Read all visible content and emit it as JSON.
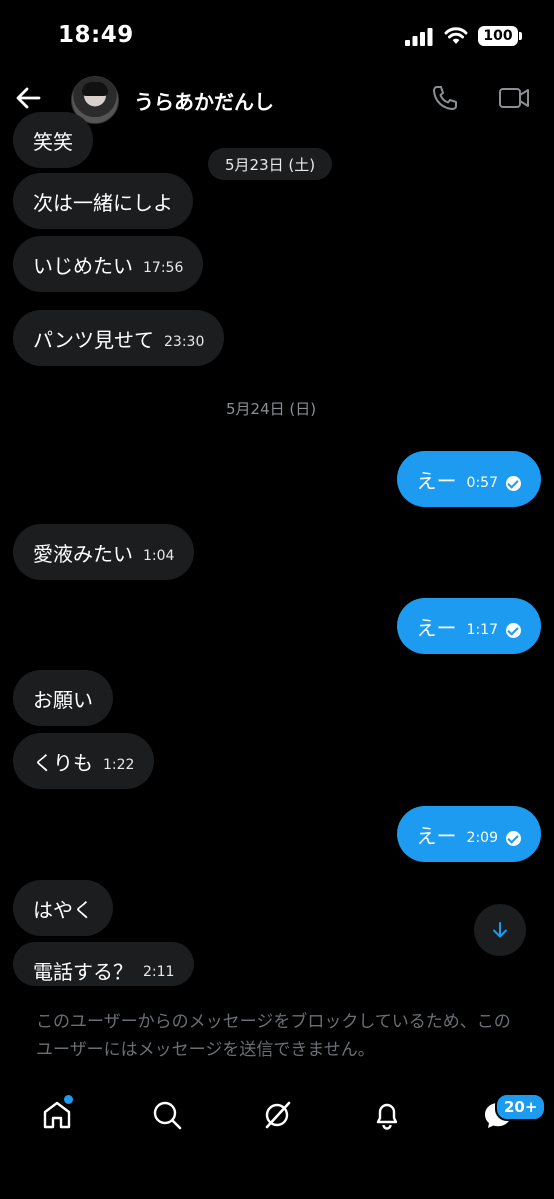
{
  "status_bar": {
    "time": "18:49",
    "battery": "100"
  },
  "header": {
    "name": "うらあかだんし"
  },
  "messages": [
    {
      "text": "笑笑",
      "time": ""
    },
    {
      "text": "次は一緒にしよ",
      "time": ""
    },
    {
      "text": "いじめたい",
      "time": "17:56"
    },
    {
      "text": "パンツ見せて",
      "time": "23:30"
    },
    {
      "text": "えー",
      "time": "0:57"
    },
    {
      "text": "愛液みたい",
      "time": "1:04"
    },
    {
      "text": "えー",
      "time": "1:17"
    },
    {
      "text": "お願い",
      "time": ""
    },
    {
      "text": "くりも",
      "time": "1:22"
    },
    {
      "text": "えー",
      "time": "2:09"
    },
    {
      "text": "はやく",
      "time": ""
    },
    {
      "text": "電話する？",
      "time": "2:11"
    }
  ],
  "dates": {
    "d1": "5月23日 (土)",
    "d2": "5月24日 (日)"
  },
  "blocked_notice": "このユーザーからのメッセージをブロックしているため、このユーザーにはメッセージを送信できません。",
  "tabbar": {
    "messages_badge": "20+"
  },
  "colors": {
    "accent": "#1d9bf0",
    "bubble_in": "#1c1d1f",
    "background": "#000000"
  },
  "icons": [
    "back-arrow-icon",
    "phone-icon",
    "video-icon",
    "arrow-down-icon",
    "home-icon",
    "search-icon",
    "grok-icon",
    "bell-icon",
    "messages-icon"
  ]
}
